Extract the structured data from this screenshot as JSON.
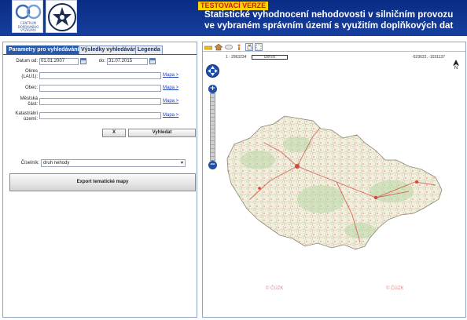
{
  "header": {
    "logo_cdv_text": "CENTRUM DOPRAVNÍHO VÝZKUMU",
    "logo_police_text": "POLICIE ČESKÉ REPUBLIKY",
    "test_badge": "TESTOVACÍ VERZE",
    "title_line1": "Statistické vyhodnocení nehodovosti v silničním provozu",
    "title_line2": "ve vybraném správním území s využitím doplňkových dat"
  },
  "tabs": [
    {
      "label": "Parametry pro vyhledávání",
      "active": true
    },
    {
      "label": "Výsledky vyhledávání",
      "active": false
    },
    {
      "label": "Legenda",
      "active": false
    }
  ],
  "form": {
    "date_from_label": "Datum od:",
    "date_from_value": "01.01.2007",
    "date_to_label": "do:",
    "date_to_value": "31.07.2015",
    "okres_label_1": "Okres",
    "okres_label_2": "(LAU1):",
    "obec_label": "Obec:",
    "mestska_label_1": "Městská",
    "mestska_label_2": "část:",
    "katastr_label_1": "Katastrální",
    "katastr_label_2": "území:",
    "map_link": "Mapa >",
    "clear_button": "X",
    "search_button": "Vyhledat",
    "ciselnik_label": "Číselník:",
    "ciselnik_value": "druh nehody",
    "export_button": "Export tematické mapy"
  },
  "map": {
    "scale_text": "1 : 2963234",
    "scale_bar_label": "100 km",
    "coordinates": "-523622, -1031137",
    "north_label": "N",
    "watermark": "© ČÚZK",
    "tools": [
      "ruler-icon",
      "home-icon",
      "eraser-icon",
      "info-icon",
      "pan-icon",
      "zoom-box-icon"
    ]
  },
  "colors": {
    "header_bg": "#0a2c85",
    "tab_active": "#2a5aa8",
    "test_badge_bg": "#ffd400",
    "test_badge_fg": "#d21414"
  }
}
